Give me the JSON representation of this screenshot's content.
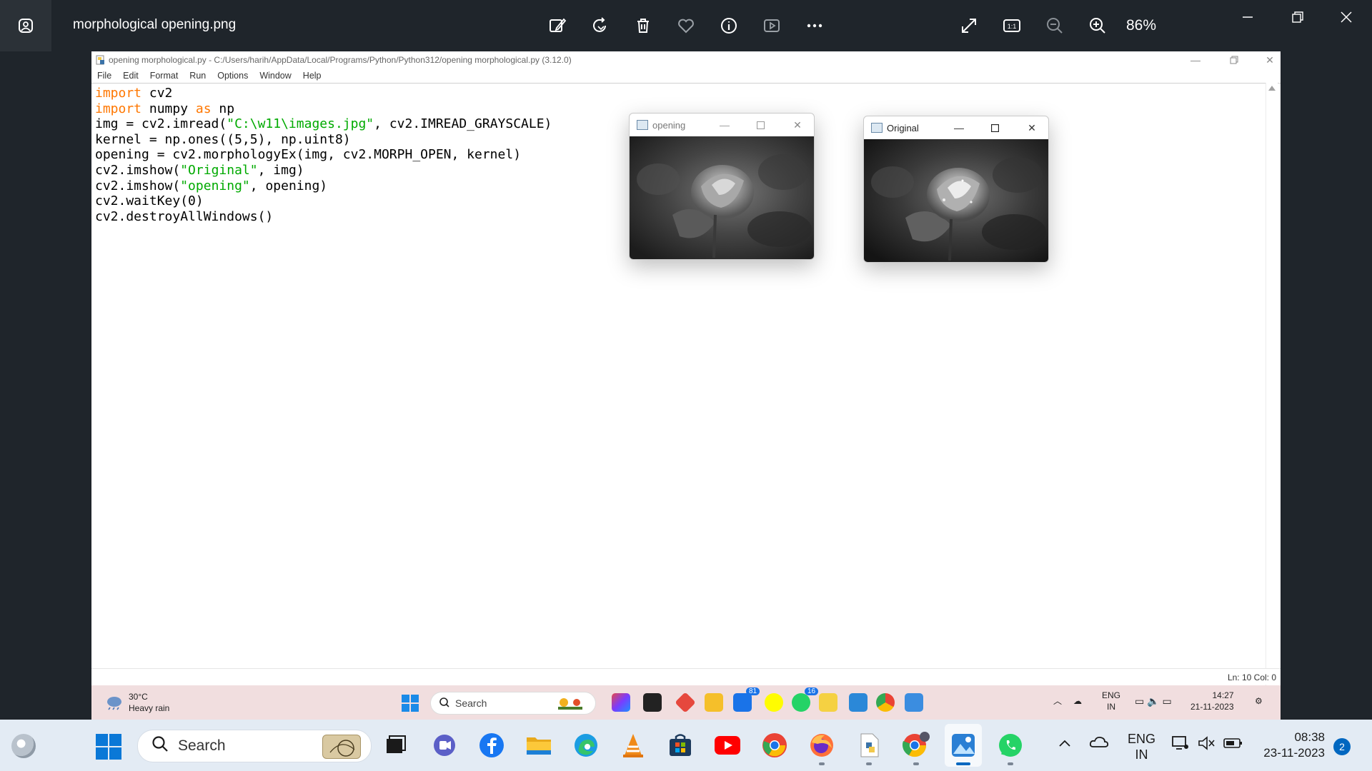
{
  "viewer": {
    "title": "morphological opening.png",
    "zoom": "86%",
    "toolbar_icons": [
      "edit-icon",
      "rotate-icon",
      "delete-icon",
      "favorite-icon",
      "info-icon",
      "slideshow-icon",
      "more-icon"
    ],
    "right_icons": [
      "fullscreen-icon",
      "actual-size-icon",
      "zoom-out-icon",
      "zoom-in-icon"
    ],
    "actual_size_label": "1:1"
  },
  "idle": {
    "title": "opening morphological.py - C:/Users/harih/AppData/Local/Programs/Python/Python312/opening morphological.py (3.12.0)",
    "menu": [
      "File",
      "Edit",
      "Format",
      "Run",
      "Options",
      "Window",
      "Help"
    ],
    "code": [
      [
        {
          "t": "import",
          "c": "kw"
        },
        {
          "t": " cv2",
          "c": ""
        }
      ],
      [
        {
          "t": "import",
          "c": "kw"
        },
        {
          "t": " numpy ",
          "c": ""
        },
        {
          "t": "as",
          "c": "kw"
        },
        {
          "t": " np",
          "c": ""
        }
      ],
      [
        {
          "t": "img = cv2.imread(",
          "c": ""
        },
        {
          "t": "\"C:\\w11\\images.jpg\"",
          "c": "str"
        },
        {
          "t": ", cv2.IMREAD_GRAYSCALE)",
          "c": ""
        }
      ],
      [
        {
          "t": "kernel = np.ones((5,5), np.uint8)",
          "c": ""
        }
      ],
      [
        {
          "t": "opening = cv2.morphologyEx(img, cv2.MORPH_OPEN, kernel)",
          "c": ""
        }
      ],
      [
        {
          "t": "cv2.imshow(",
          "c": ""
        },
        {
          "t": "\"Original\"",
          "c": "str"
        },
        {
          "t": ", img)",
          "c": ""
        }
      ],
      [
        {
          "t": "cv2.imshow(",
          "c": ""
        },
        {
          "t": "\"opening\"",
          "c": "str"
        },
        {
          "t": ", opening)",
          "c": ""
        }
      ],
      [
        {
          "t": "cv2.waitKey(0)",
          "c": ""
        }
      ],
      [
        {
          "t": "cv2.destroyAllWindows()",
          "c": ""
        }
      ]
    ],
    "status": "Ln: 10   Col: 0"
  },
  "windows": {
    "opening": {
      "title": "opening"
    },
    "original": {
      "title": "Original"
    }
  },
  "inner_taskbar": {
    "temp": "30°C",
    "weather": "Heavy rain",
    "search": "Search",
    "badge_mail": "81",
    "badge_whatsapp": "16",
    "lang1": "ENG",
    "lang2": "IN",
    "time": "14:27",
    "date": "21-11-2023"
  },
  "taskbar": {
    "search": "Search",
    "lang1": "ENG",
    "lang2": "IN",
    "time": "08:38",
    "date": "23-11-2023",
    "notif_count": "2"
  }
}
